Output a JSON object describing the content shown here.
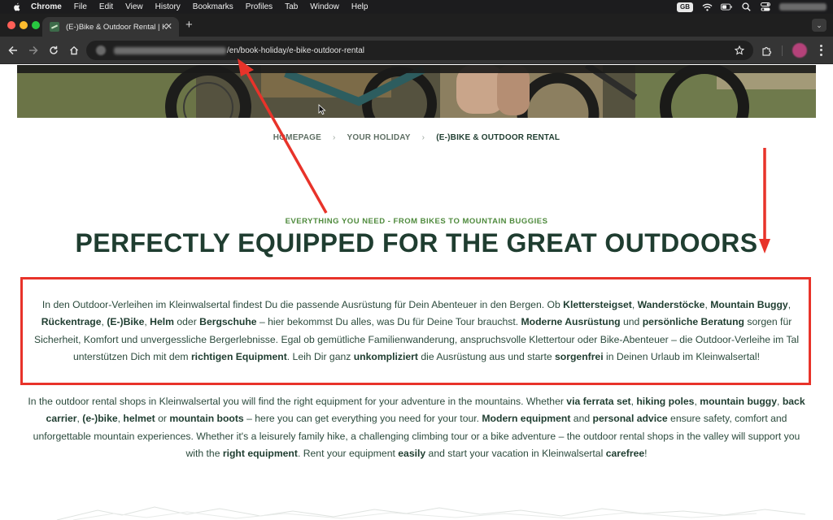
{
  "menubar": {
    "app_name": "Chrome",
    "items": [
      "File",
      "Edit",
      "View",
      "History",
      "Bookmarks",
      "Profiles",
      "Tab",
      "Window",
      "Help"
    ],
    "input_source": "GB"
  },
  "browser": {
    "tab_title": "(E-)Bike & Outdoor Rental | K",
    "url_path": "/en/book-holiday/e-bike-outdoor-rental"
  },
  "breadcrumb": {
    "items": [
      "HOMEPAGE",
      "YOUR HOLIDAY",
      "(E-)BIKE & OUTDOOR RENTAL"
    ]
  },
  "kicker": "EVERYTHING YOU NEED - FROM BIKES TO MOUNTAIN BUGGIES",
  "headline": "PERFECTLY EQUIPPED FOR THE GREAT OUTDOORS",
  "paragraph_de": [
    {
      "t": "In den Outdoor-Verleihen im Kleinwalsertal findest Du die passende Ausrüstung für Dein Abenteuer in den Bergen. Ob "
    },
    {
      "t": "Klettersteigset",
      "b": true
    },
    {
      "t": ", "
    },
    {
      "t": "Wanderstöcke",
      "b": true
    },
    {
      "t": ", "
    },
    {
      "t": "Mountain Buggy",
      "b": true
    },
    {
      "t": ", "
    },
    {
      "t": "Rückentrage",
      "b": true
    },
    {
      "t": ", "
    },
    {
      "t": "(E-)Bike",
      "b": true
    },
    {
      "t": ", "
    },
    {
      "t": "Helm",
      "b": true
    },
    {
      "t": " oder "
    },
    {
      "t": "Bergschuhe",
      "b": true
    },
    {
      "t": " – hier bekommst Du alles, was Du für Deine Tour brauchst. "
    },
    {
      "t": "Moderne Ausrüstung",
      "b": true
    },
    {
      "t": " und "
    },
    {
      "t": "persönliche Beratung",
      "b": true
    },
    {
      "t": " sorgen für Sicherheit, Komfort und unvergessliche Bergerlebnisse. Egal ob gemütliche Familienwanderung, anspruchsvolle Klettertour oder Bike-Abenteuer – die Outdoor-Verleihe im Tal unterstützen Dich mit dem "
    },
    {
      "t": "richtigen Equipment",
      "b": true
    },
    {
      "t": ". Leih Dir ganz "
    },
    {
      "t": "unkompliziert",
      "b": true
    },
    {
      "t": " die Ausrüstung aus und starte "
    },
    {
      "t": "sorgenfrei",
      "b": true
    },
    {
      "t": " in Deinen Urlaub im Kleinwalsertal!"
    }
  ],
  "paragraph_en": [
    {
      "t": "In the outdoor rental shops in Kleinwalsertal you will find the right equipment for your adventure in the mountains. Whether "
    },
    {
      "t": "via ferrata set",
      "b": true
    },
    {
      "t": ", "
    },
    {
      "t": "hiking poles",
      "b": true
    },
    {
      "t": ", "
    },
    {
      "t": "mountain buggy",
      "b": true
    },
    {
      "t": ", "
    },
    {
      "t": "back carrier",
      "b": true
    },
    {
      "t": ", "
    },
    {
      "t": "(e-)bike",
      "b": true
    },
    {
      "t": ", "
    },
    {
      "t": "helmet",
      "b": true
    },
    {
      "t": " or "
    },
    {
      "t": "mountain boots",
      "b": true
    },
    {
      "t": " – here you can get everything you need for your tour. "
    },
    {
      "t": "Modern equipment",
      "b": true
    },
    {
      "t": " and "
    },
    {
      "t": "personal advice",
      "b": true
    },
    {
      "t": " ensure safety, comfort and unforgettable mountain experiences. Whether it's a leisurely family hike, a challenging climbing tour or a bike adventure – the outdoor rental shops in the valley will support you with the "
    },
    {
      "t": "right equipment",
      "b": true
    },
    {
      "t": ". Rent your equipment "
    },
    {
      "t": "easily",
      "b": true
    },
    {
      "t": " and start your vacation in Kleinwalsertal "
    },
    {
      "t": "carefree",
      "b": true
    },
    {
      "t": "!"
    }
  ],
  "colors": {
    "headline": "#1f3d30",
    "kicker": "#4e8a3c",
    "annotation_red": "#e8332a"
  }
}
